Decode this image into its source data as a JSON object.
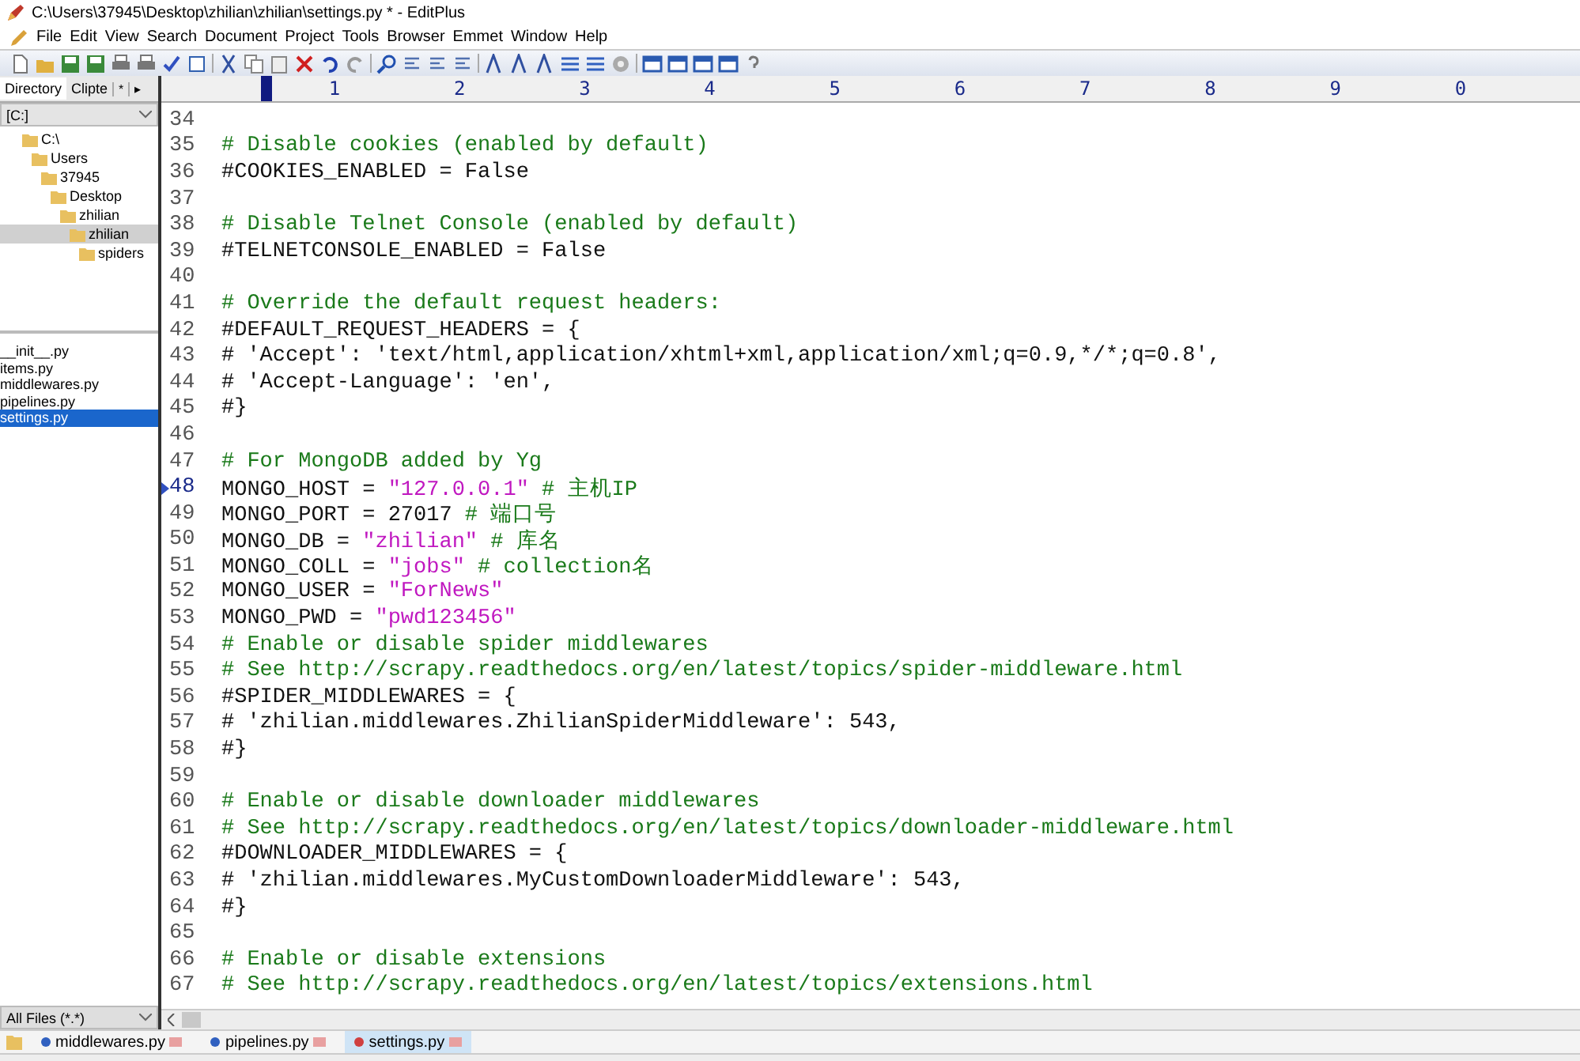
{
  "window": {
    "title": "C:\\Users\\37945\\Desktop\\zhilian\\zhilian\\settings.py * - EditPlus"
  },
  "menu": [
    "File",
    "Edit",
    "View",
    "Search",
    "Document",
    "Project",
    "Tools",
    "Browser",
    "Emmet",
    "Window",
    "Help"
  ],
  "sidebar": {
    "tabs": [
      {
        "label": "Directory",
        "selected": true
      },
      {
        "label": "Clipte",
        "selected": false
      }
    ],
    "tab_scroll": [
      "*",
      "▸"
    ],
    "drive": "[C:]",
    "tree": [
      {
        "label": "C:\\",
        "selected": false,
        "children": [
          {
            "label": "Users",
            "selected": false,
            "children": [
              {
                "label": "37945",
                "selected": false,
                "children": [
                  {
                    "label": "Desktop",
                    "selected": false,
                    "children": [
                      {
                        "label": "zhilian",
                        "selected": false,
                        "children": [
                          {
                            "label": "zhilian",
                            "selected": true,
                            "children": [
                              {
                                "label": "spiders",
                                "selected": false
                              }
                            ]
                          }
                        ]
                      }
                    ]
                  }
                ]
              }
            ]
          }
        ]
      }
    ],
    "files": [
      {
        "label": "__init__.py",
        "selected": false
      },
      {
        "label": "items.py",
        "selected": false
      },
      {
        "label": "middlewares.py",
        "selected": false
      },
      {
        "label": "pipelines.py",
        "selected": false
      },
      {
        "label": "settings.py",
        "selected": true
      }
    ],
    "filter": "All Files (*.*)"
  },
  "ruler": [
    "1",
    "2",
    "3",
    "4",
    "5",
    "6",
    "7",
    "8",
    "9",
    "0"
  ],
  "editor": {
    "lines": [
      {
        "num": "34",
        "current": false
      },
      {
        "num": "35",
        "current": false,
        "segs": [
          {
            "kind": "comment",
            "text": "# Disable cookies (enabled by default)"
          }
        ]
      },
      {
        "num": "36",
        "current": false,
        "segs": [
          {
            "kind": "code",
            "text": "#COOKIES_ENABLED = False"
          }
        ]
      },
      {
        "num": "37",
        "current": false
      },
      {
        "num": "38",
        "current": false,
        "segs": [
          {
            "kind": "comment",
            "text": "# Disable Telnet Console (enabled by default)"
          }
        ]
      },
      {
        "num": "39",
        "current": false,
        "segs": [
          {
            "kind": "code",
            "text": "#TELNETCONSOLE_ENABLED = False"
          }
        ]
      },
      {
        "num": "40",
        "current": false
      },
      {
        "num": "41",
        "current": false,
        "segs": [
          {
            "kind": "comment",
            "text": "# Override the default request headers:"
          }
        ]
      },
      {
        "num": "42",
        "current": false,
        "segs": [
          {
            "kind": "code",
            "text": "#DEFAULT_REQUEST_HEADERS = {"
          }
        ]
      },
      {
        "num": "43",
        "current": false,
        "segs": [
          {
            "kind": "code",
            "text": "#   'Accept': 'text/html,application/xhtml+xml,application/xml;q=0.9,*/*;q=0.8',"
          }
        ]
      },
      {
        "num": "44",
        "current": false,
        "segs": [
          {
            "kind": "code",
            "text": "#   'Accept-Language': 'en',"
          }
        ]
      },
      {
        "num": "45",
        "current": false,
        "segs": [
          {
            "kind": "code",
            "text": "#}"
          }
        ]
      },
      {
        "num": "46",
        "current": false
      },
      {
        "num": "47",
        "current": false,
        "segs": [
          {
            "kind": "comment",
            "text": "# For MongoDB added by Yg"
          }
        ]
      },
      {
        "num": "48",
        "current": true,
        "segs": [
          {
            "kind": "code",
            "text": "MONGO_HOST = "
          },
          {
            "kind": "string",
            "text": "\"127.0.0.1\""
          },
          {
            "kind": "comment",
            "text": "  # 主机IP"
          }
        ]
      },
      {
        "num": "49",
        "current": false,
        "segs": [
          {
            "kind": "code",
            "text": "MONGO_PORT = 27017"
          },
          {
            "kind": "comment",
            "text": "  # 端口号"
          }
        ]
      },
      {
        "num": "50",
        "current": false,
        "segs": [
          {
            "kind": "code",
            "text": "MONGO_DB = "
          },
          {
            "kind": "string",
            "text": "\"zhilian\""
          },
          {
            "kind": "comment",
            "text": "  # 库名"
          }
        ]
      },
      {
        "num": "51",
        "current": false,
        "segs": [
          {
            "kind": "code",
            "text": "MONGO_COLL = "
          },
          {
            "kind": "string",
            "text": "\"jobs\""
          },
          {
            "kind": "comment",
            "text": "  # collection名"
          }
        ]
      },
      {
        "num": "52",
        "current": false,
        "segs": [
          {
            "kind": "code",
            "text": "MONGO_USER = "
          },
          {
            "kind": "string",
            "text": "\"ForNews\""
          }
        ]
      },
      {
        "num": "53",
        "current": false,
        "segs": [
          {
            "kind": "code",
            "text": "MONGO_PWD = "
          },
          {
            "kind": "string",
            "text": "\"pwd123456\""
          }
        ]
      },
      {
        "num": "54",
        "current": false,
        "segs": [
          {
            "kind": "comment",
            "text": "# Enable or disable spider middlewares"
          }
        ]
      },
      {
        "num": "55",
        "current": false,
        "segs": [
          {
            "kind": "comment",
            "text": "# See http://scrapy.readthedocs.org/en/latest/topics/spider-middleware.html"
          }
        ]
      },
      {
        "num": "56",
        "current": false,
        "segs": [
          {
            "kind": "code",
            "text": "#SPIDER_MIDDLEWARES = {"
          }
        ]
      },
      {
        "num": "57",
        "current": false,
        "segs": [
          {
            "kind": "code",
            "text": "#    'zhilian.middlewares.ZhilianSpiderMiddleware': 543,"
          }
        ]
      },
      {
        "num": "58",
        "current": false,
        "segs": [
          {
            "kind": "code",
            "text": "#}"
          }
        ]
      },
      {
        "num": "59",
        "current": false
      },
      {
        "num": "60",
        "current": false,
        "segs": [
          {
            "kind": "comment",
            "text": "# Enable or disable downloader middlewares"
          }
        ]
      },
      {
        "num": "61",
        "current": false,
        "segs": [
          {
            "kind": "comment",
            "text": "# See http://scrapy.readthedocs.org/en/latest/topics/downloader-middleware.html"
          }
        ]
      },
      {
        "num": "62",
        "current": false,
        "segs": [
          {
            "kind": "code",
            "text": "#DOWNLOADER_MIDDLEWARES = {"
          }
        ]
      },
      {
        "num": "63",
        "current": false,
        "segs": [
          {
            "kind": "code",
            "text": "#    'zhilian.middlewares.MyCustomDownloaderMiddleware': 543,"
          }
        ]
      },
      {
        "num": "64",
        "current": false,
        "segs": [
          {
            "kind": "code",
            "text": "#}"
          }
        ]
      },
      {
        "num": "65",
        "current": false
      },
      {
        "num": "66",
        "current": false,
        "segs": [
          {
            "kind": "comment",
            "text": "# Enable or disable extensions"
          }
        ]
      },
      {
        "num": "67",
        "current": false,
        "segs": [
          {
            "kind": "comment",
            "text": "# See http://scrapy.readthedocs.org/en/latest/topics/extensions.html"
          }
        ]
      }
    ]
  },
  "doc_tabs": [
    {
      "label": "middlewares.py",
      "selected": false
    },
    {
      "label": "pipelines.py",
      "selected": false
    },
    {
      "label": "settings.py",
      "selected": true
    }
  ]
}
